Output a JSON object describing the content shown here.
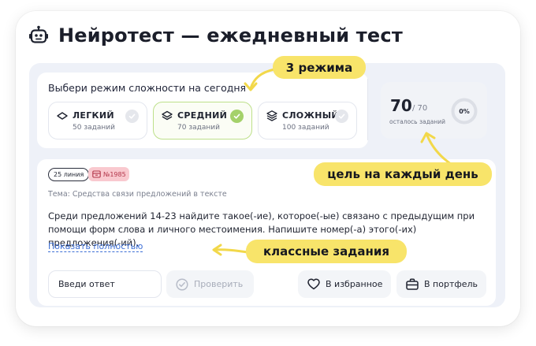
{
  "header": {
    "title": "Нейротест — ежедневный тест",
    "icon": "robot-icon"
  },
  "modes": {
    "title": "Выбери режим сложности на сегодня",
    "items": [
      {
        "name": "ЛЕГКИЙ",
        "count": "50 заданий",
        "icon": "layer-single-icon",
        "selected": false
      },
      {
        "name": "СРЕДНИЙ",
        "count": "70 заданий",
        "icon": "layers-double-icon",
        "selected": true
      },
      {
        "name": "СЛОЖНЫЙ",
        "count": "100 заданий",
        "icon": "layers-triple-icon",
        "selected": false
      }
    ]
  },
  "goal": {
    "remaining": "70",
    "total": "/ 70",
    "label": "осталось заданий",
    "progress_label": "0%",
    "progress": 0
  },
  "task": {
    "line_tag": "25 линия",
    "number_tag": "№1985",
    "topic": "Тема: Средства связи предложений в тексте",
    "text": "Среди предложений 14-23 найдите такое(-ие), которое(-ые) связано с предыдущим при помощи форм слова и личного местоимения. Напишите номер(-а) этого(-их) предложения(-ий).",
    "show_more": "Показать полностью",
    "answer_placeholder": "Введи ответ",
    "check_label": "Проверить",
    "favorite_label": "В избранное",
    "portfolio_label": "В портфель"
  },
  "annotations": {
    "modes_callout": "3 режима",
    "goal_callout": "цель на каждый день",
    "tasks_callout": "классные задания"
  },
  "colors": {
    "accent_green": "#a4d16a",
    "highlight_yellow": "#f8e46a",
    "tag_pink": "#f9c9cf",
    "link_blue": "#3d6fd6"
  }
}
